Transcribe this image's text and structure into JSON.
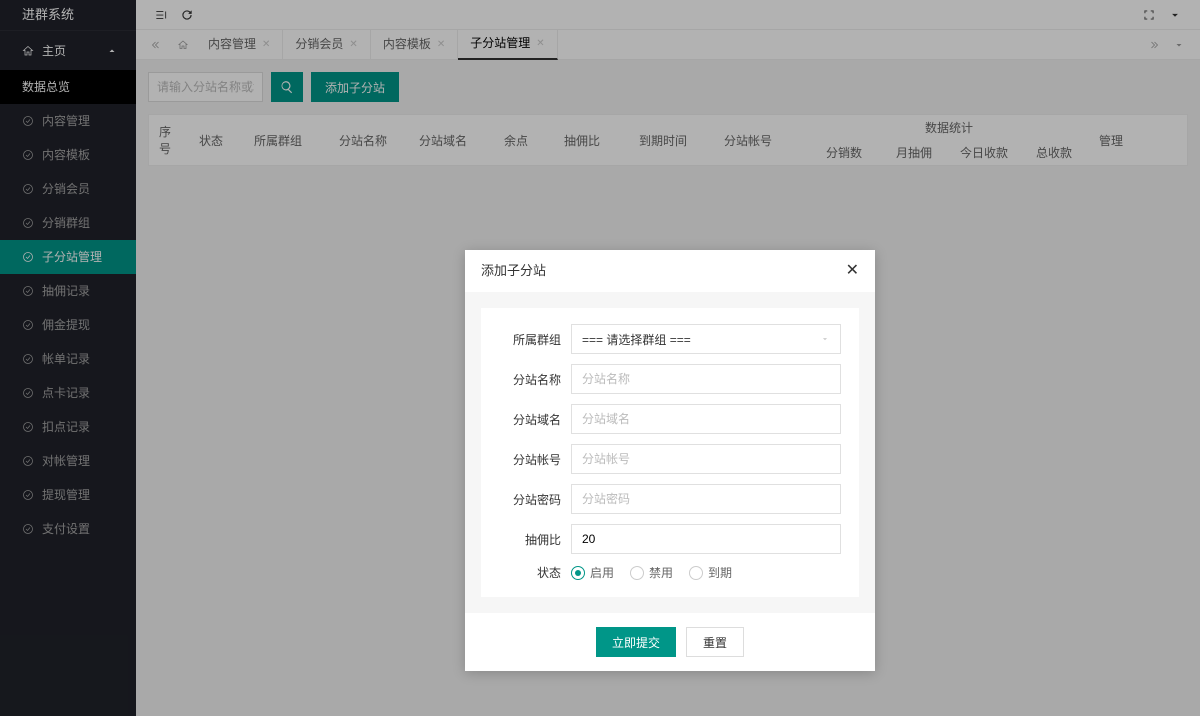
{
  "logo": "进群系统",
  "nav_header": "主页",
  "sidebar": {
    "items": [
      {
        "label": "数据总览",
        "selected": true
      },
      {
        "label": "内容管理"
      },
      {
        "label": "内容模板"
      },
      {
        "label": "分销会员"
      },
      {
        "label": "分销群组"
      },
      {
        "label": "子分站管理",
        "active": true
      },
      {
        "label": "抽佣记录"
      },
      {
        "label": "佣金提现"
      },
      {
        "label": "帐单记录"
      },
      {
        "label": "点卡记录"
      },
      {
        "label": "扣点记录"
      },
      {
        "label": "对帐管理"
      },
      {
        "label": "提现管理"
      },
      {
        "label": "支付设置"
      }
    ]
  },
  "tabs": [
    {
      "label": "内容管理"
    },
    {
      "label": "分销会员"
    },
    {
      "label": "内容模板"
    },
    {
      "label": "子分站管理",
      "active": true
    }
  ],
  "search": {
    "placeholder": "请输入分站名称或域名"
  },
  "btn_add": "添加子分站",
  "table_headers": {
    "seq": "序号",
    "status": "状态",
    "group": "所属群组",
    "name": "分站名称",
    "domain": "分站域名",
    "balance": "余点",
    "commission": "抽佣比",
    "expire": "到期时间",
    "account": "分站帐号",
    "stats": "数据统计",
    "stats_sub": {
      "dist": "分销数",
      "month": "月抽佣",
      "today": "今日收款",
      "total": "总收款"
    },
    "manage": "管理"
  },
  "modal": {
    "title": "添加子分站",
    "fields": {
      "group": {
        "label": "所属群组",
        "placeholder": "=== 请选择群组 ==="
      },
      "name": {
        "label": "分站名称",
        "placeholder": "分站名称"
      },
      "domain": {
        "label": "分站域名",
        "placeholder": "分站域名"
      },
      "account": {
        "label": "分站帐号",
        "placeholder": "分站帐号"
      },
      "password": {
        "label": "分站密码",
        "placeholder": "分站密码"
      },
      "commission": {
        "label": "抽佣比",
        "value": "20"
      },
      "status": {
        "label": "状态",
        "options": {
          "enable": "启用",
          "disable": "禁用",
          "expire": "到期"
        }
      }
    },
    "submit": "立即提交",
    "reset": "重置"
  }
}
